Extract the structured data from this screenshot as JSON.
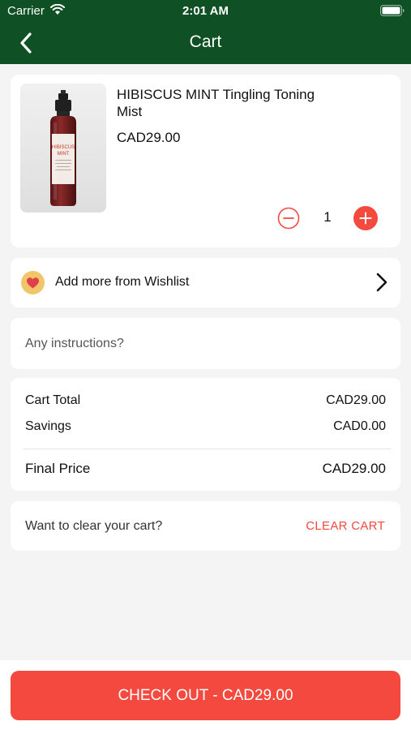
{
  "status_bar": {
    "carrier": "Carrier",
    "time": "2:01 AM"
  },
  "header": {
    "title": "Cart"
  },
  "cart_item": {
    "name": "HIBISCUS MINT Tingling Toning Mist",
    "price": "CAD29.00",
    "quantity": "1",
    "image_label_line1": "HIBISCUS",
    "image_label_line2": "MINT"
  },
  "wishlist": {
    "label": "Add more from Wishlist"
  },
  "instructions": {
    "placeholder": "Any instructions?",
    "value": ""
  },
  "totals": {
    "cart_total_label": "Cart Total",
    "cart_total_value": "CAD29.00",
    "savings_label": "Savings",
    "savings_value": "CAD0.00",
    "final_price_label": "Final Price",
    "final_price_value": "CAD29.00"
  },
  "clear_cart": {
    "question": "Want to clear your cart?",
    "button_label": "CLEAR CART"
  },
  "checkout": {
    "button_label": "CHECK OUT - CAD29.00"
  },
  "colors": {
    "header_green": "#0f5125",
    "accent_red": "#f4493f",
    "background": "#f4f4f4"
  },
  "icons": [
    "wifi-icon",
    "battery-icon",
    "back-arrow-icon",
    "minus-circle-icon",
    "plus-circle-icon",
    "heart-icon",
    "chevron-right-icon"
  ]
}
